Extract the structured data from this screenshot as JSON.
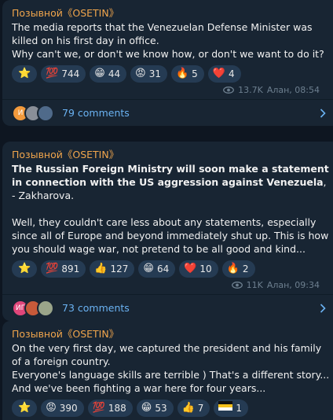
{
  "messages": [
    {
      "author": "Позывной《OSETIN》",
      "text": "The media reports that the Venezuelan Defense Minister was killed on his first day in office.\nWhy can't we, or don't we know how, or don't we want to do it?",
      "reactions": [
        {
          "icon": "star",
          "emoji": "⭐",
          "count": ""
        },
        {
          "icon": "hundred-points",
          "emoji": "💯",
          "count": "744"
        },
        {
          "icon": "grinning-face",
          "emoji": "😁",
          "count": "44"
        },
        {
          "icon": "angry-face",
          "emoji": "😡",
          "count": "31"
        },
        {
          "icon": "fire",
          "emoji": "🔥",
          "count": "5"
        },
        {
          "icon": "heart",
          "emoji": "❤️",
          "count": "4"
        }
      ],
      "views": "13.7K",
      "signature": "Алан, 08:54",
      "comments": "79 comments",
      "avatars": [
        {
          "label": "И",
          "color": "#f39a3c"
        },
        {
          "label": "",
          "color": "#8a8f98"
        },
        {
          "label": "",
          "color": "#4f6a8a"
        }
      ]
    },
    {
      "author": "Позывной《OSETIN》",
      "text_bold": "The Russian Foreign Ministry will soon make a statement in connection with the US aggression against Venezuela",
      "text_after_bold": ", - Zakharova.",
      "text": "Well, they couldn't care less about any statements, especially since all of Europe and beyond immediately shut up. This is how you should wage war, not pretend to be all good and kind...",
      "reactions": [
        {
          "icon": "star",
          "emoji": "⭐",
          "count": ""
        },
        {
          "icon": "hundred-points",
          "emoji": "💯",
          "count": "891"
        },
        {
          "icon": "thumbs-up",
          "emoji": "👍",
          "count": "127"
        },
        {
          "icon": "grinning-face",
          "emoji": "😁",
          "count": "64"
        },
        {
          "icon": "heart",
          "emoji": "❤️",
          "count": "10"
        },
        {
          "icon": "fire",
          "emoji": "🔥",
          "count": "2"
        }
      ],
      "views": "11K",
      "signature": "Алан, 09:34",
      "comments": "73 comments",
      "avatars": [
        {
          "label": "ИГ",
          "color": "#e0467a"
        },
        {
          "label": "",
          "color": "#c75a3a"
        },
        {
          "label": "",
          "color": "#9aa58a"
        }
      ]
    },
    {
      "author": "Позывной《OSETIN》",
      "text": "On the very first day, we captured the president and his family of a foreign country.\nEveryone's language skills are terrible ) That's a different story...\nAnd we've been fighting a war here for four years...",
      "reactions": [
        {
          "icon": "star",
          "emoji": "⭐",
          "count": ""
        },
        {
          "icon": "angry-face",
          "emoji": "😡",
          "count": "390"
        },
        {
          "icon": "hundred-points",
          "emoji": "💯",
          "count": "188"
        },
        {
          "icon": "grinning-face",
          "emoji": "😁",
          "count": "53"
        },
        {
          "icon": "thumbs-up",
          "emoji": "👍",
          "count": "7"
        },
        {
          "icon": "flag",
          "emoji": "🏳",
          "count": "1"
        }
      ]
    }
  ]
}
